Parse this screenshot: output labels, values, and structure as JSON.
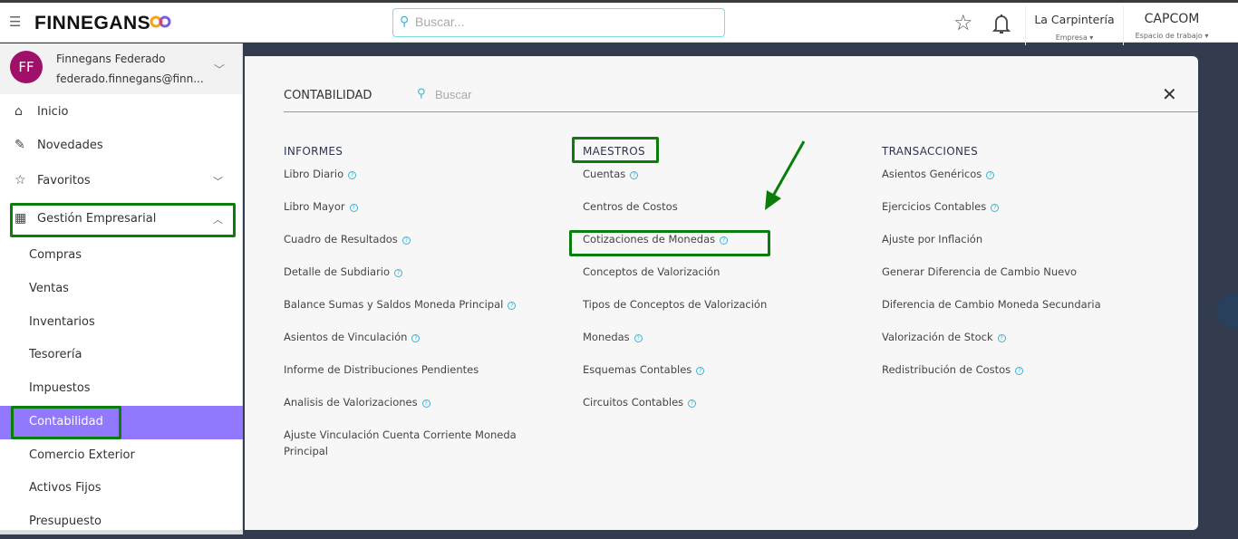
{
  "header": {
    "brand": "FINNEGANS",
    "search_placeholder": "Buscar...",
    "company": "La Carpintería",
    "company_label": "Empresa",
    "workspace": "CAPCOM",
    "workspace_label": "Espacio de trabajo"
  },
  "user": {
    "initials": "FF",
    "name": "Finnegans Federado",
    "email": "federado.finnegans@finn..."
  },
  "sidebar": {
    "items": [
      {
        "label": "Inicio"
      },
      {
        "label": "Novedades"
      },
      {
        "label": "Favoritos"
      },
      {
        "label": "Gestión Empresarial"
      }
    ],
    "sub_items": [
      "Compras",
      "Ventas",
      "Inventarios",
      "Tesorería",
      "Impuestos",
      "Contabilidad",
      "Comercio Exterior",
      "Activos Fijos",
      "Presupuesto"
    ]
  },
  "panel": {
    "title": "CONTABILIDAD",
    "search_placeholder": "Buscar",
    "columns": [
      {
        "title": "INFORMES",
        "items": [
          {
            "label": "Libro Diario",
            "help": true
          },
          {
            "label": "Libro Mayor",
            "help": true
          },
          {
            "label": "Cuadro de Resultados",
            "help": true
          },
          {
            "label": "Detalle de Subdiario",
            "help": true
          },
          {
            "label": "Balance Sumas y Saldos Moneda Principal",
            "help": true
          },
          {
            "label": "Asientos de Vinculación",
            "help": true
          },
          {
            "label": "Informe de Distribuciones Pendientes",
            "help": false
          },
          {
            "label": "Analisis de Valorizaciones",
            "help": true
          },
          {
            "label": "Ajuste Vinculación Cuenta Corriente Moneda Principal",
            "help": false
          }
        ]
      },
      {
        "title": "MAESTROS",
        "items": [
          {
            "label": "Cuentas",
            "help": true
          },
          {
            "label": "Centros de Costos",
            "help": false
          },
          {
            "label": "Cotizaciones de Monedas",
            "help": true
          },
          {
            "label": "Conceptos de Valorización",
            "help": false
          },
          {
            "label": "Tipos de Conceptos de Valorización",
            "help": false
          },
          {
            "label": "Monedas",
            "help": true
          },
          {
            "label": "Esquemas Contables",
            "help": true
          },
          {
            "label": "Circuitos Contables",
            "help": true
          }
        ]
      },
      {
        "title": "TRANSACCIONES",
        "items": [
          {
            "label": "Asientos Genéricos",
            "help": true
          },
          {
            "label": "Ejercicios Contables",
            "help": true
          },
          {
            "label": "Ajuste por Inflación",
            "help": false
          },
          {
            "label": "Generar Diferencia de Cambio Nuevo",
            "help": false
          },
          {
            "label": "Diferencia de Cambio Moneda Secundaria",
            "help": false
          },
          {
            "label": "Valorización de Stock",
            "help": true
          },
          {
            "label": "Redistribución de Costos",
            "help": true
          }
        ]
      }
    ]
  },
  "colors": {
    "accent": "#9178fd",
    "highlight": "#0a7d0a",
    "avatar": "#a0106a",
    "help": "#3bb4d3"
  }
}
